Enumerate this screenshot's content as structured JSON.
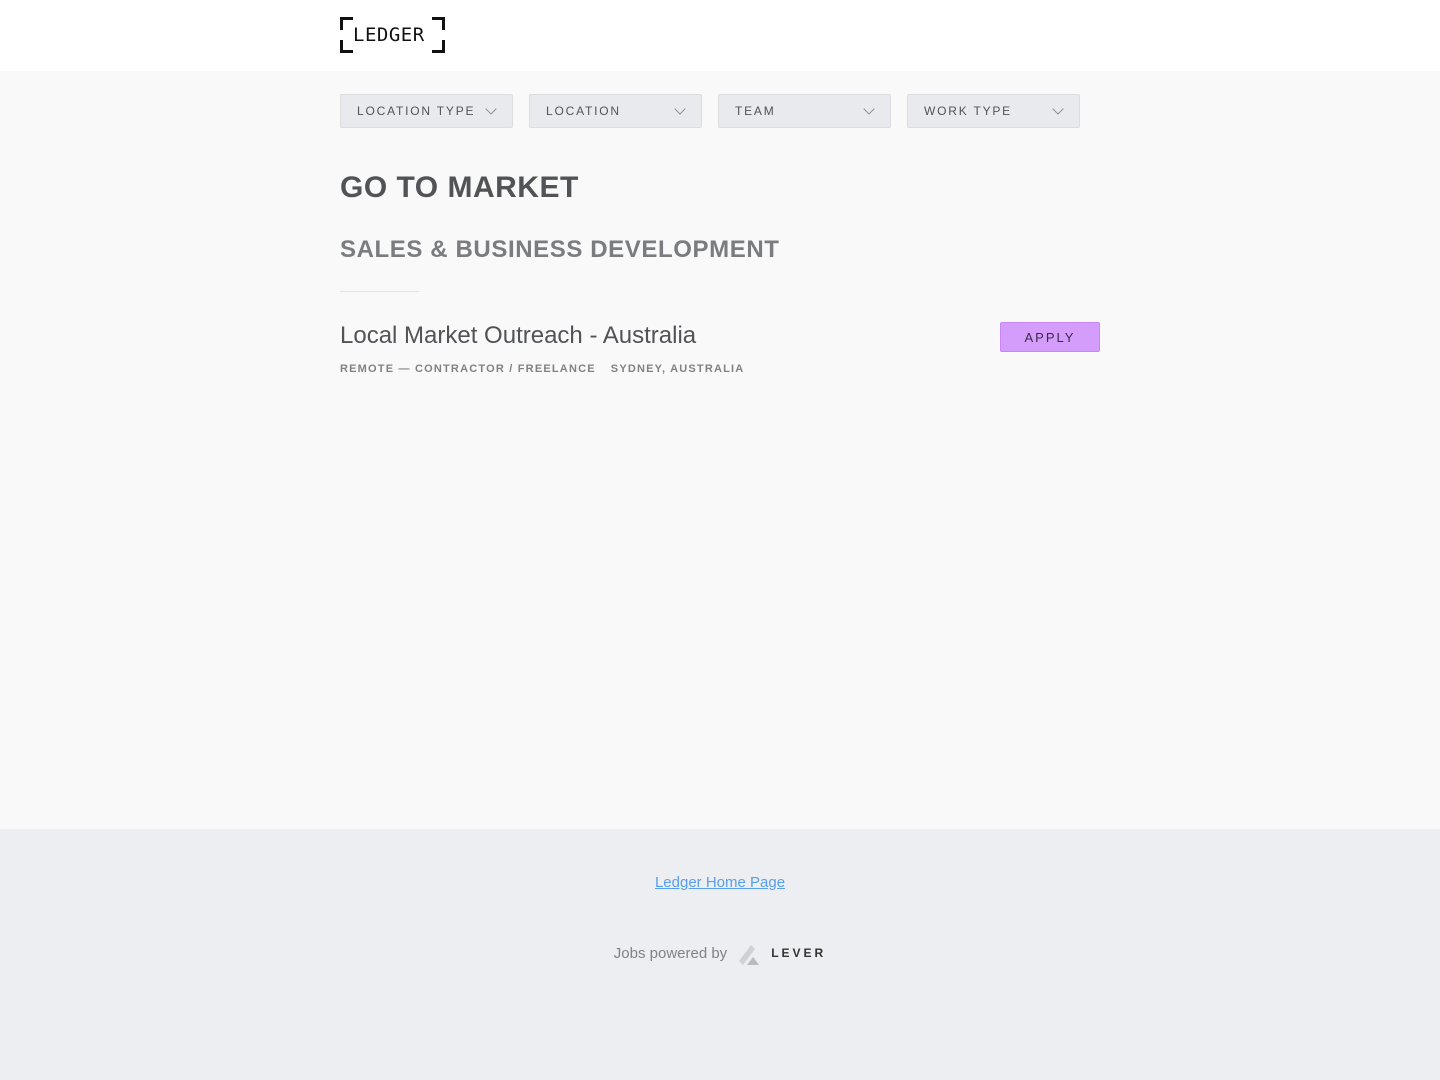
{
  "header": {
    "logo_text": "LEDGER"
  },
  "filters": [
    {
      "label": "LOCATION TYPE"
    },
    {
      "label": "LOCATION"
    },
    {
      "label": "TEAM"
    },
    {
      "label": "WORK TYPE"
    }
  ],
  "postings": {
    "category": "GO TO MARKET",
    "subcategory": "SALES & BUSINESS DEVELOPMENT",
    "items": [
      {
        "title": "Local Market Outreach - Australia",
        "commitment": "REMOTE — CONTRACTOR / FREELANCE",
        "location": "SYDNEY, AUSTRALIA",
        "apply_label": "APPLY"
      }
    ]
  },
  "footer": {
    "home_link": "Ledger Home Page",
    "powered_by": "Jobs powered by",
    "powered_brand": "LEVER"
  },
  "colors": {
    "apply_button": "#d49dfb",
    "link": "#579eee",
    "footer_bg": "#eceef1",
    "page_bg": "#f9f9f9"
  }
}
